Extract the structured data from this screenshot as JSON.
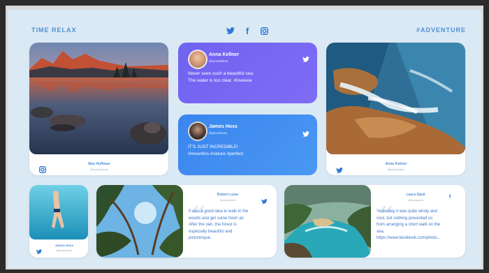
{
  "header": {
    "brand_left": "TIME RELAX",
    "brand_right": "#ADVENTURE",
    "icons": [
      "twitter-icon",
      "facebook-icon",
      "instagram-icon"
    ]
  },
  "posts": {
    "p1": {
      "name": "Max Hoffman",
      "handle": "@maxhoffman",
      "source": "instagram-icon"
    },
    "p2": {
      "name": "Anna Kellner",
      "handle": "@annakellner",
      "message": "Never seen such a beautiful sea.\nThe water is too clear. #lovesea",
      "source": "twitter-icon"
    },
    "p3": {
      "name": "James Hoxs",
      "handle": "@jameshoxs",
      "message": "IT'S JUST INCREDIBLE!\n#mountins #nature #perfect",
      "source": "twitter-icon"
    },
    "p4": {
      "name": "Anna Kellner",
      "handle": "@annakellner",
      "source": "twitter-icon"
    },
    "p5": {
      "name": "James Hoxs",
      "handle": "@jameshoxs",
      "source": "twitter-icon"
    },
    "p6": {
      "name": "Robert Luise",
      "handle": "@robertluise",
      "message": "It was a good idea to walk in the\nwoods and get some fresh air.\nAfter the rain, the forest is\nespecially beautiful and\npicturesque.",
      "source": "twitter-icon"
    },
    "p7": {
      "name": "Laura Ojeal",
      "handle": "@lauraojeal",
      "message": "Yesterday it was quite windy and\ncool, but nothing prevented us\nfrom arranging a short walk on the\nsea.\nhttps://www.facebook.com/photo...",
      "source": "facebook-icon"
    }
  },
  "colors": {
    "bg": "#dbe9f4",
    "accent": "#4f8fd6",
    "purple": "#7166ee",
    "blue": "#3f8ef0"
  }
}
